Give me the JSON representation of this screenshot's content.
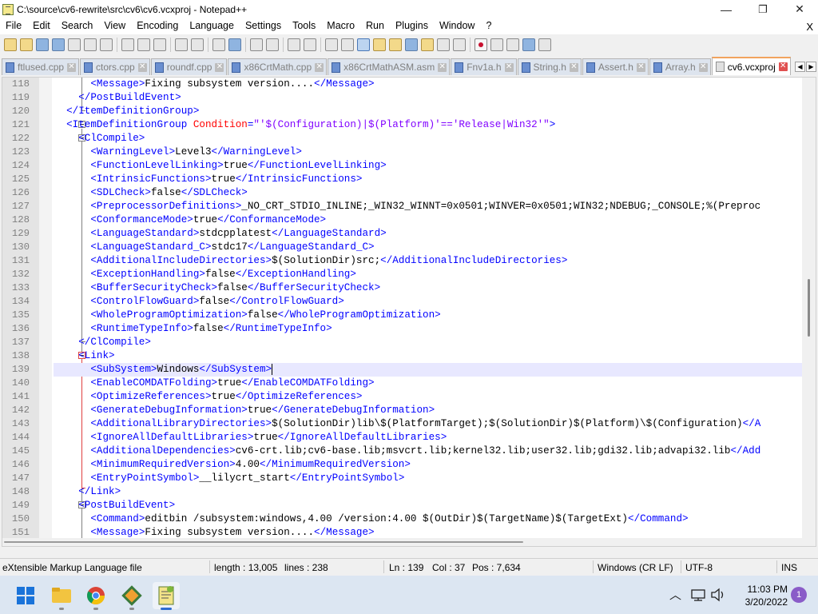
{
  "window": {
    "title": "C:\\source\\cv6-rewrite\\src\\cv6\\cv6.vcxproj - Notepad++",
    "minimize": "—",
    "maximize": "❐",
    "close": "✕"
  },
  "menu": {
    "items": [
      "File",
      "Edit",
      "Search",
      "View",
      "Encoding",
      "Language",
      "Settings",
      "Tools",
      "Macro",
      "Run",
      "Plugins",
      "Window",
      "?"
    ],
    "close_doc": "X"
  },
  "tabs": [
    {
      "label": "ftlused.cpp",
      "active": false
    },
    {
      "label": "ctors.cpp",
      "active": false
    },
    {
      "label": "roundf.cpp",
      "active": false
    },
    {
      "label": "x86CrtMath.cpp",
      "active": false
    },
    {
      "label": "x86CrtMathASM.asm",
      "active": false
    },
    {
      "label": "Fnv1a.h",
      "active": false
    },
    {
      "label": "String.h",
      "active": false
    },
    {
      "label": "Assert.h",
      "active": false
    },
    {
      "label": "Array.h",
      "active": false
    },
    {
      "label": "cv6.vcxproj",
      "active": true
    }
  ],
  "tab_nav": {
    "left": "◀",
    "right": "▶"
  },
  "editor": {
    "current_line": 139,
    "lines": [
      {
        "n": "118",
        "indent": 6,
        "tokens": [
          {
            "t": "tag",
            "v": "<Message>"
          },
          {
            "t": "text",
            "v": "Fixing subsystem version...."
          },
          {
            "t": "tag",
            "v": "</Message>"
          }
        ]
      },
      {
        "n": "119",
        "indent": 4,
        "tokens": [
          {
            "t": "tag",
            "v": "</PostBuildEvent>"
          }
        ]
      },
      {
        "n": "120",
        "indent": 2,
        "tokens": [
          {
            "t": "tag",
            "v": "</ItemDefinitionGroup>"
          }
        ]
      },
      {
        "n": "121",
        "indent": 2,
        "tokens": [
          {
            "t": "tag",
            "v": "<ItemDefinitionGroup "
          },
          {
            "t": "attr",
            "v": "Condition"
          },
          {
            "t": "tag",
            "v": "="
          },
          {
            "t": "aval",
            "v": "\"'$(Configuration)|$(Platform)'=='Release|Win32'\""
          },
          {
            "t": "tag",
            "v": ">"
          }
        ]
      },
      {
        "n": "122",
        "indent": 4,
        "tokens": [
          {
            "t": "tag",
            "v": "<ClCompile>"
          }
        ]
      },
      {
        "n": "123",
        "indent": 6,
        "tokens": [
          {
            "t": "tag",
            "v": "<WarningLevel>"
          },
          {
            "t": "text",
            "v": "Level3"
          },
          {
            "t": "tag",
            "v": "</WarningLevel>"
          }
        ]
      },
      {
        "n": "124",
        "indent": 6,
        "tokens": [
          {
            "t": "tag",
            "v": "<FunctionLevelLinking>"
          },
          {
            "t": "text",
            "v": "true"
          },
          {
            "t": "tag",
            "v": "</FunctionLevelLinking>"
          }
        ]
      },
      {
        "n": "125",
        "indent": 6,
        "tokens": [
          {
            "t": "tag",
            "v": "<IntrinsicFunctions>"
          },
          {
            "t": "text",
            "v": "true"
          },
          {
            "t": "tag",
            "v": "</IntrinsicFunctions>"
          }
        ]
      },
      {
        "n": "126",
        "indent": 6,
        "tokens": [
          {
            "t": "tag",
            "v": "<SDLCheck>"
          },
          {
            "t": "text",
            "v": "false"
          },
          {
            "t": "tag",
            "v": "</SDLCheck>"
          }
        ]
      },
      {
        "n": "127",
        "indent": 6,
        "tokens": [
          {
            "t": "tag",
            "v": "<PreprocessorDefinitions>"
          },
          {
            "t": "text",
            "v": "_NO_CRT_STDIO_INLINE;_WIN32_WINNT=0x0501;WINVER=0x0501;WIN32;NDEBUG;_CONSOLE;%(Preproc"
          }
        ]
      },
      {
        "n": "128",
        "indent": 6,
        "tokens": [
          {
            "t": "tag",
            "v": "<ConformanceMode>"
          },
          {
            "t": "text",
            "v": "true"
          },
          {
            "t": "tag",
            "v": "</ConformanceMode>"
          }
        ]
      },
      {
        "n": "129",
        "indent": 6,
        "tokens": [
          {
            "t": "tag",
            "v": "<LanguageStandard>"
          },
          {
            "t": "text",
            "v": "stdcpplatest"
          },
          {
            "t": "tag",
            "v": "</LanguageStandard>"
          }
        ]
      },
      {
        "n": "130",
        "indent": 6,
        "tokens": [
          {
            "t": "tag",
            "v": "<LanguageStandard_C>"
          },
          {
            "t": "text",
            "v": "stdc17"
          },
          {
            "t": "tag",
            "v": "</LanguageStandard_C>"
          }
        ]
      },
      {
        "n": "131",
        "indent": 6,
        "tokens": [
          {
            "t": "tag",
            "v": "<AdditionalIncludeDirectories>"
          },
          {
            "t": "text",
            "v": "$(SolutionDir)src;"
          },
          {
            "t": "tag",
            "v": "</AdditionalIncludeDirectories>"
          }
        ]
      },
      {
        "n": "132",
        "indent": 6,
        "tokens": [
          {
            "t": "tag",
            "v": "<ExceptionHandling>"
          },
          {
            "t": "text",
            "v": "false"
          },
          {
            "t": "tag",
            "v": "</ExceptionHandling>"
          }
        ]
      },
      {
        "n": "133",
        "indent": 6,
        "tokens": [
          {
            "t": "tag",
            "v": "<BufferSecurityCheck>"
          },
          {
            "t": "text",
            "v": "false"
          },
          {
            "t": "tag",
            "v": "</BufferSecurityCheck>"
          }
        ]
      },
      {
        "n": "134",
        "indent": 6,
        "tokens": [
          {
            "t": "tag",
            "v": "<ControlFlowGuard>"
          },
          {
            "t": "text",
            "v": "false"
          },
          {
            "t": "tag",
            "v": "</ControlFlowGuard>"
          }
        ]
      },
      {
        "n": "135",
        "indent": 6,
        "tokens": [
          {
            "t": "tag",
            "v": "<WholeProgramOptimization>"
          },
          {
            "t": "text",
            "v": "false"
          },
          {
            "t": "tag",
            "v": "</WholeProgramOptimization>"
          }
        ]
      },
      {
        "n": "136",
        "indent": 6,
        "tokens": [
          {
            "t": "tag",
            "v": "<RuntimeTypeInfo>"
          },
          {
            "t": "text",
            "v": "false"
          },
          {
            "t": "tag",
            "v": "</RuntimeTypeInfo>"
          }
        ]
      },
      {
        "n": "137",
        "indent": 4,
        "tokens": [
          {
            "t": "tag",
            "v": "</ClCompile>"
          }
        ]
      },
      {
        "n": "138",
        "indent": 4,
        "tokens": [
          {
            "t": "tag",
            "v": "<Link>"
          }
        ]
      },
      {
        "n": "139",
        "indent": 6,
        "tokens": [
          {
            "t": "tag",
            "v": "<SubSystem>"
          },
          {
            "t": "text",
            "v": "Windows"
          },
          {
            "t": "tag",
            "v": "</SubSystem>"
          }
        ]
      },
      {
        "n": "140",
        "indent": 6,
        "tokens": [
          {
            "t": "tag",
            "v": "<EnableCOMDATFolding>"
          },
          {
            "t": "text",
            "v": "true"
          },
          {
            "t": "tag",
            "v": "</EnableCOMDATFolding>"
          }
        ]
      },
      {
        "n": "141",
        "indent": 6,
        "tokens": [
          {
            "t": "tag",
            "v": "<OptimizeReferences>"
          },
          {
            "t": "text",
            "v": "true"
          },
          {
            "t": "tag",
            "v": "</OptimizeReferences>"
          }
        ]
      },
      {
        "n": "142",
        "indent": 6,
        "tokens": [
          {
            "t": "tag",
            "v": "<GenerateDebugInformation>"
          },
          {
            "t": "text",
            "v": "true"
          },
          {
            "t": "tag",
            "v": "</GenerateDebugInformation>"
          }
        ]
      },
      {
        "n": "143",
        "indent": 6,
        "tokens": [
          {
            "t": "tag",
            "v": "<AdditionalLibraryDirectories>"
          },
          {
            "t": "text",
            "v": "$(SolutionDir)lib\\$(PlatformTarget);$(SolutionDir)$(Platform)\\$(Configuration)"
          },
          {
            "t": "tag",
            "v": "</A"
          }
        ]
      },
      {
        "n": "144",
        "indent": 6,
        "tokens": [
          {
            "t": "tag",
            "v": "<IgnoreAllDefaultLibraries>"
          },
          {
            "t": "text",
            "v": "true"
          },
          {
            "t": "tag",
            "v": "</IgnoreAllDefaultLibraries>"
          }
        ]
      },
      {
        "n": "145",
        "indent": 6,
        "tokens": [
          {
            "t": "tag",
            "v": "<AdditionalDependencies>"
          },
          {
            "t": "text",
            "v": "cv6-crt.lib;cv6-base.lib;msvcrt.lib;kernel32.lib;user32.lib;gdi32.lib;advapi32.lib"
          },
          {
            "t": "tag",
            "v": "</Add"
          }
        ]
      },
      {
        "n": "146",
        "indent": 6,
        "tokens": [
          {
            "t": "tag",
            "v": "<MinimumRequiredVersion>"
          },
          {
            "t": "text",
            "v": "4.00"
          },
          {
            "t": "tag",
            "v": "</MinimumRequiredVersion>"
          }
        ]
      },
      {
        "n": "147",
        "indent": 6,
        "tokens": [
          {
            "t": "tag",
            "v": "<EntryPointSymbol>"
          },
          {
            "t": "text",
            "v": "__lilycrt_start"
          },
          {
            "t": "tag",
            "v": "</EntryPointSymbol>"
          }
        ]
      },
      {
        "n": "148",
        "indent": 4,
        "tokens": [
          {
            "t": "tag",
            "v": "</Link>"
          }
        ]
      },
      {
        "n": "149",
        "indent": 4,
        "tokens": [
          {
            "t": "tag",
            "v": "<PostBuildEvent>"
          }
        ]
      },
      {
        "n": "150",
        "indent": 6,
        "tokens": [
          {
            "t": "tag",
            "v": "<Command>"
          },
          {
            "t": "text",
            "v": "editbin /subsystem:windows,4.00 /version:4.00 $(OutDir)$(TargetName)$(TargetExt)"
          },
          {
            "t": "tag",
            "v": "</Command>"
          }
        ]
      },
      {
        "n": "151",
        "indent": 6,
        "tokens": [
          {
            "t": "tag",
            "v": "<Message>"
          },
          {
            "t": "text",
            "v": "Fixing subsystem version...."
          },
          {
            "t": "tag",
            "v": "</Message>"
          }
        ]
      }
    ]
  },
  "status": {
    "filetype": "eXtensible Markup Language file",
    "length": "length : 13,005",
    "lines": "lines : 238",
    "ln": "Ln : 139",
    "col": "Col : 37",
    "pos": "Pos : 7,634",
    "eol": "Windows (CR LF)",
    "encoding": "UTF-8",
    "mode": "INS"
  },
  "taskbar": {
    "time": "11:03 PM",
    "date": "3/20/2022",
    "notification_count": "1",
    "tray_chevron": "︿"
  },
  "colors": {
    "tag": "#0000ff",
    "attribute": "#ff0000",
    "attribute_value": "#8000ff",
    "active_tab_accent": "#f2a35e",
    "current_line_bg": "#e8e8ff",
    "fold_current": "#e04040"
  }
}
